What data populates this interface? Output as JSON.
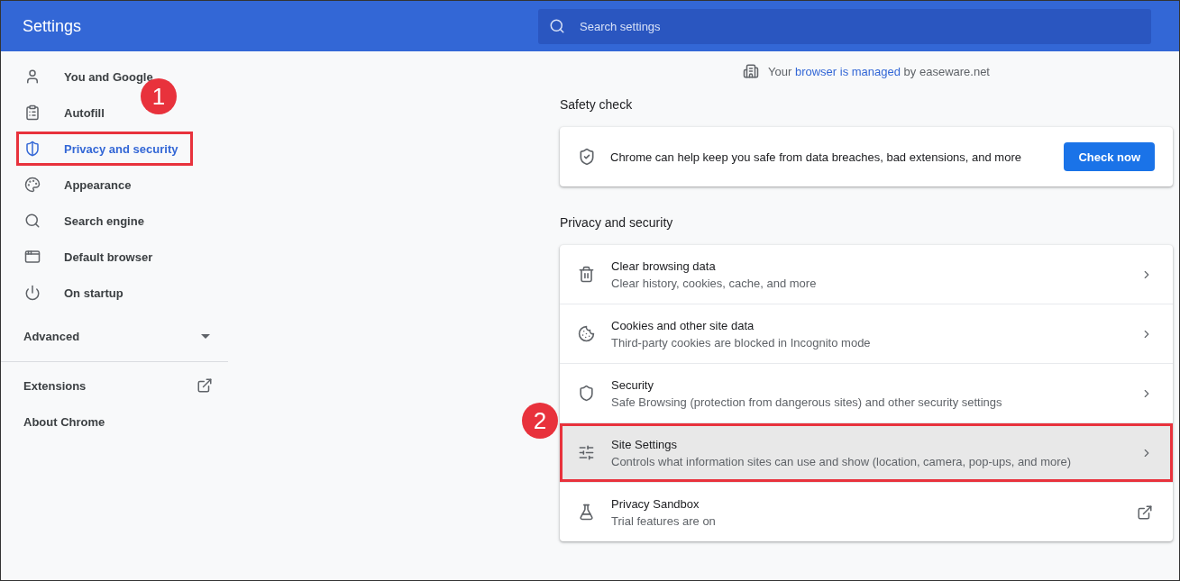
{
  "header": {
    "title": "Settings",
    "search": {
      "placeholder": "Search settings"
    }
  },
  "sidebar": {
    "items": [
      {
        "label": "You and Google",
        "selected": false,
        "highlighted": false
      },
      {
        "label": "Autofill",
        "selected": false,
        "highlighted": false
      },
      {
        "label": "Privacy and security",
        "selected": true,
        "highlighted": true,
        "callout": "1"
      },
      {
        "label": "Appearance",
        "selected": false,
        "highlighted": false
      },
      {
        "label": "Search engine",
        "selected": false,
        "highlighted": false
      },
      {
        "label": "Default browser",
        "selected": false,
        "highlighted": false
      },
      {
        "label": "On startup",
        "selected": false,
        "highlighted": false
      }
    ],
    "advanced": {
      "label": "Advanced",
      "expanded": false
    },
    "links": [
      {
        "label": "Extensions",
        "kind": "external"
      },
      {
        "label": "About Chrome",
        "kind": "plain"
      }
    ]
  },
  "managed_notice": {
    "prefix": "Your",
    "link": "browser is managed",
    "suffix": "by easeware.net"
  },
  "safety_check": {
    "heading": "Safety check",
    "text": "Chrome can help keep you safe from data breaches, bad extensions, and more",
    "button": "Check now"
  },
  "privacy": {
    "heading": "Privacy and security",
    "rows": [
      {
        "title": "Clear browsing data",
        "subtitle": "Clear history, cookies, cache, and more",
        "kind": "arrow",
        "hovered": false,
        "highlighted": false
      },
      {
        "title": "Cookies and other site data",
        "subtitle": "Third-party cookies are blocked in Incognito mode",
        "kind": "arrow",
        "hovered": false,
        "highlighted": false
      },
      {
        "title": "Security",
        "subtitle": "Safe Browsing (protection from dangerous sites) and other security settings",
        "kind": "arrow",
        "hovered": false,
        "highlighted": false
      },
      {
        "title": "Site Settings",
        "subtitle": "Controls what information sites can use and show (location, camera, pop-ups, and more)",
        "kind": "arrow",
        "hovered": true,
        "highlighted": true,
        "callout": "2"
      },
      {
        "title": "Privacy Sandbox",
        "subtitle": "Trial features are on",
        "kind": "external",
        "hovered": false,
        "highlighted": false
      }
    ]
  }
}
